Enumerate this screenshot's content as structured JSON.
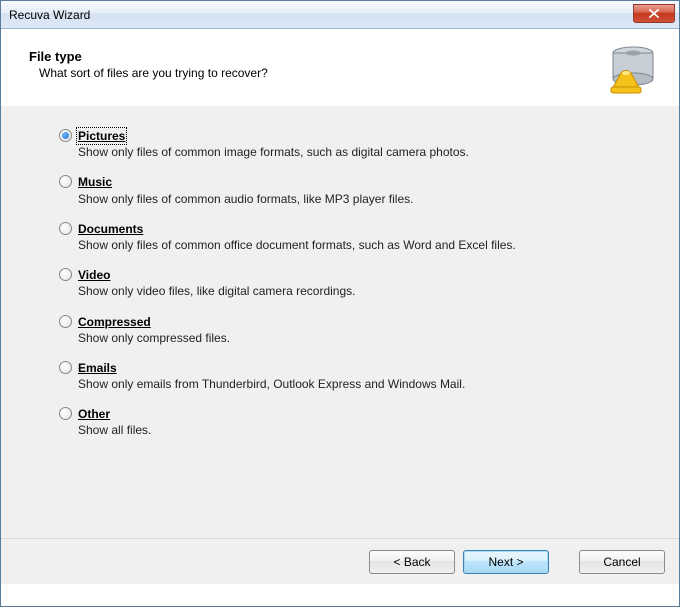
{
  "window": {
    "title": "Recuva Wizard"
  },
  "header": {
    "title": "File type",
    "description": "What sort of files are you trying to recover?"
  },
  "options": [
    {
      "label": "Pictures",
      "description": "Show only files of common image formats, such as digital camera photos.",
      "selected": true
    },
    {
      "label": "Music",
      "description": "Show only files of common audio formats, like MP3 player files.",
      "selected": false
    },
    {
      "label": "Documents",
      "description": "Show only files of common office document formats, such as Word and Excel files.",
      "selected": false
    },
    {
      "label": "Video",
      "description": "Show only video files, like digital camera recordings.",
      "selected": false
    },
    {
      "label": "Compressed",
      "description": "Show only compressed files.",
      "selected": false
    },
    {
      "label": "Emails",
      "description": "Show only emails from Thunderbird, Outlook Express and Windows Mail.",
      "selected": false
    },
    {
      "label": "Other",
      "description": "Show all files.",
      "selected": false
    }
  ],
  "buttons": {
    "back": "< Back",
    "next": "Next >",
    "cancel": "Cancel"
  }
}
